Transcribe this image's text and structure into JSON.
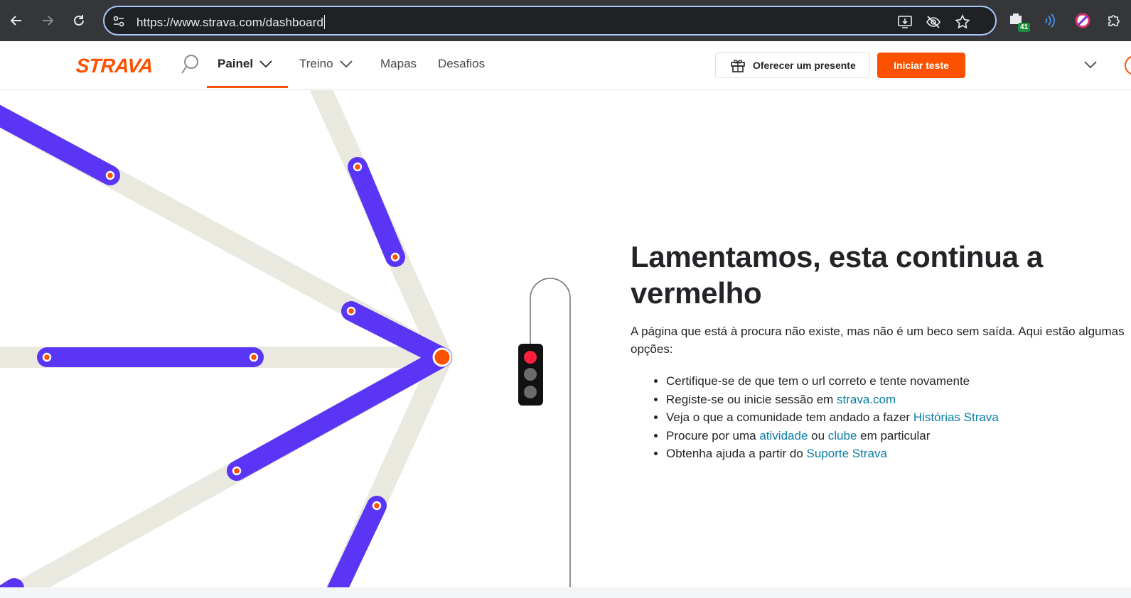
{
  "browser": {
    "url": "https://www.strava.com/dashboard",
    "extension_badge": "41",
    "icons": [
      "back-arrow-icon",
      "forward-arrow-icon",
      "reload-icon",
      "site-info-icon",
      "install-app-icon",
      "eye-off-icon",
      "star-icon",
      "extension-badge-icon",
      "wifi-waves-icon",
      "block-icon",
      "puzzle-extensions-icon"
    ]
  },
  "header": {
    "logo": "STRAVA",
    "nav": [
      {
        "label": "Painel",
        "has_dropdown": true,
        "active": true
      },
      {
        "label": "Treino",
        "has_dropdown": true,
        "active": false
      },
      {
        "label": "Mapas",
        "has_dropdown": false,
        "active": false
      },
      {
        "label": "Desafios",
        "has_dropdown": false,
        "active": false
      }
    ],
    "gift_label": "Oferecer um presente",
    "trial_label": "Iniciar teste",
    "accent_color": "#fc5200"
  },
  "content": {
    "title": "Lamentamos, esta continua a vermelho",
    "lead": "A página que está à procura não existe, mas não é um beco sem saída. Aqui estão algumas opções:",
    "items": [
      {
        "text": "Certifique-se de que tem o url correto e tente novamente",
        "link": "",
        "mid": "",
        "link2": "",
        "tail": ""
      },
      {
        "text": "Registe-se ou inicie sessão em ",
        "link": "strava.com",
        "mid": "",
        "link2": "",
        "tail": ""
      },
      {
        "text": "Veja o que a comunidade tem andado a fazer ",
        "link": "Histórias Strava",
        "mid": "",
        "link2": "",
        "tail": ""
      },
      {
        "text": "Procure por uma ",
        "link": "atividade",
        "mid": " ou ",
        "link2": "clube",
        "tail": " em particular"
      },
      {
        "text": "Obtenha ajuda a partir do ",
        "link": "Suporte Strava",
        "mid": "",
        "link2": "",
        "tail": ""
      }
    ],
    "link_color": "#0a7ea5"
  },
  "illustration": {
    "route_color": "#5b35f5",
    "road_color": "#e9e9df",
    "node_color": "#fc5200",
    "traffic_light": [
      "red",
      "gray",
      "gray"
    ]
  }
}
